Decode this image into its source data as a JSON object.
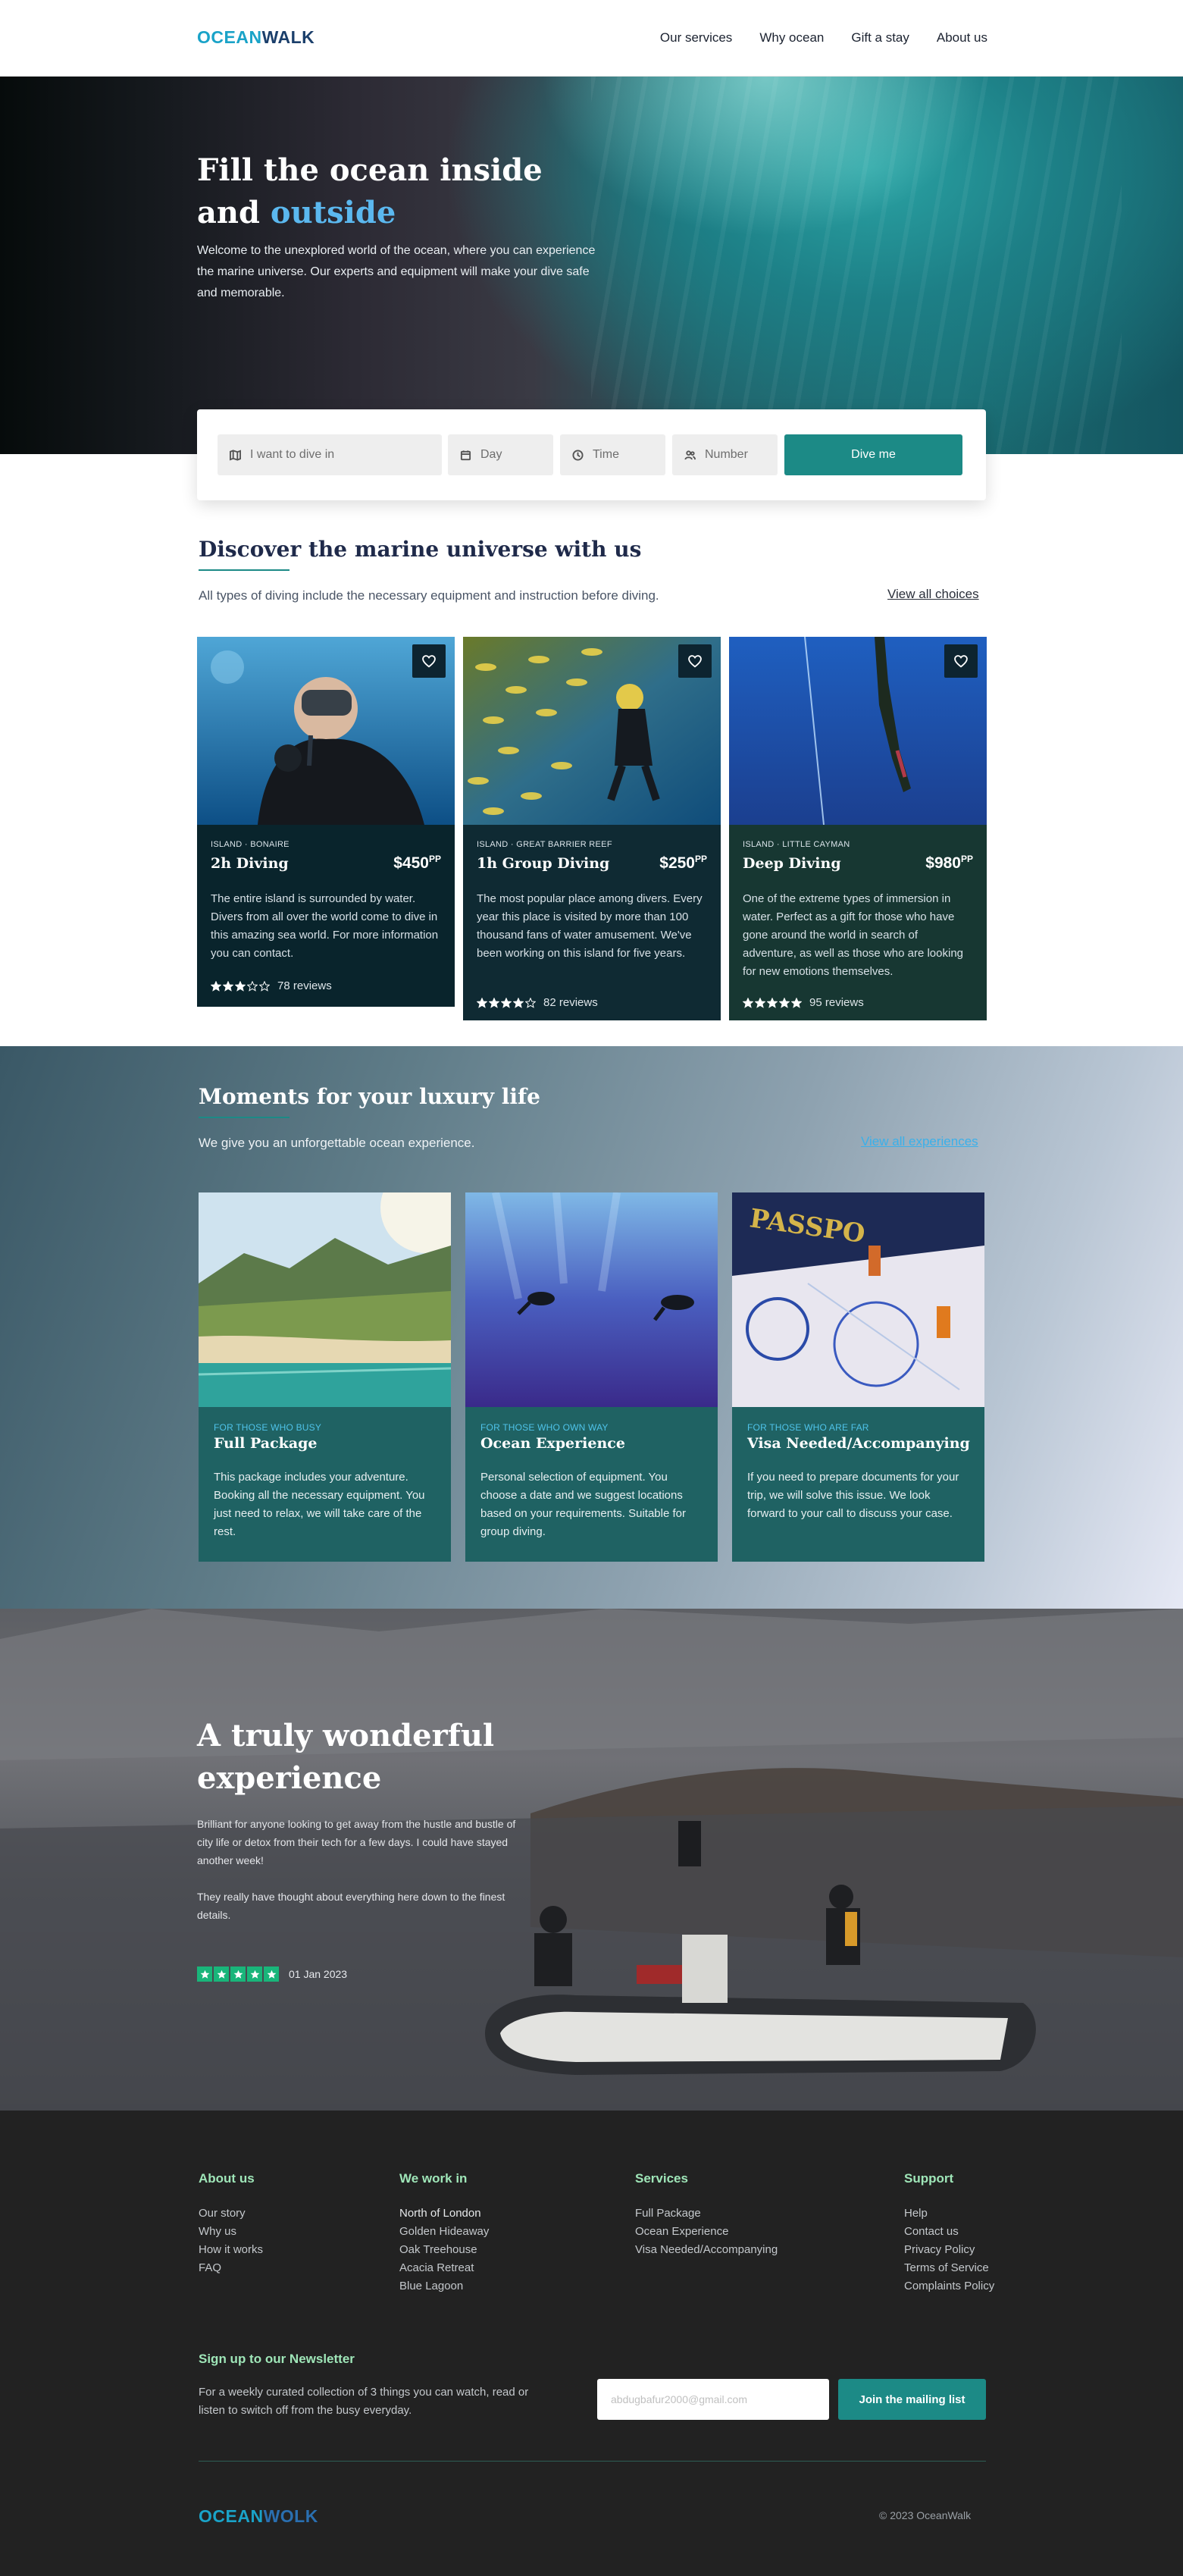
{
  "header": {
    "logo_part1": "OCEAN",
    "logo_part2": "WALK",
    "nav": [
      "Our services",
      "Why ocean",
      "Gift a stay",
      "About us"
    ]
  },
  "hero": {
    "title_line1": "Fill the ocean inside",
    "title_line2_prefix": "and ",
    "title_line2_accent": "outside",
    "description": "Welcome to the unexplored world of the ocean, where you can experience the marine universe. Our experts and equipment will make your dive safe and memorable."
  },
  "search": {
    "location_placeholder": "I want to dive in",
    "day_placeholder": "Day",
    "time_placeholder": "Time",
    "number_placeholder": "Number",
    "submit_label": "Dive me"
  },
  "discover": {
    "title": "Discover the marine universe with us",
    "subtitle": "All types of diving include the necessary equipment and instruction before diving.",
    "link": "View all choices",
    "cards": [
      {
        "location": "ISLAND · BONAIRE",
        "name": "2h Diving",
        "price": "$450",
        "price_unit": "PP",
        "description": "The entire island is surrounded by water. Divers from all over the world come to dive in this amazing sea world. For more information you can contact.",
        "rating": 3,
        "reviews": "78 reviews"
      },
      {
        "location": "ISLAND · GREAT BARRIER REEF",
        "name": "1h Group Diving",
        "price": "$250",
        "price_unit": "PP",
        "description": "The most popular place among divers. Every year this place is visited by more than 100 thousand fans of water amusement. We've been working on this island for five years.",
        "rating": 4,
        "reviews": "82 reviews"
      },
      {
        "location": "ISLAND · LITTLE CAYMAN",
        "name": "Deep Diving",
        "price": "$980",
        "price_unit": "PP",
        "description": "One of the extreme types of immersion in water. Perfect as a gift for those who have gone around the world in search of adventure, as well as those who are looking for new emotions themselves.",
        "rating": 5,
        "reviews": "95 reviews"
      }
    ]
  },
  "moments": {
    "title": "Moments for your luxury life",
    "subtitle": "We give you an unforgettable ocean experience.",
    "link": "View all experiences",
    "cards": [
      {
        "tag": "FOR THOSE WHO BUSY",
        "name": "Full Package",
        "description": "This package includes your adventure. Booking all the necessary equipment. You just need to relax, we will take care of the rest."
      },
      {
        "tag": "FOR THOSE WHO OWN WAY",
        "name": "Ocean Experience",
        "description": "Personal selection of equipment. You choose a date and we suggest locations based on your requirements. Suitable for group diving."
      },
      {
        "tag": "FOR THOSE WHO ARE FAR",
        "name": "Visa Needed/Accompanying",
        "description": "If you need to prepare documents for your trip, we will solve this issue. We look forward to your call to discuss your case."
      }
    ]
  },
  "testimonial": {
    "title": "A truly wonderful experience",
    "paragraph1": "Brilliant for anyone looking to get away from the hustle and bustle of city life or detox from their tech for a few days. I could have stayed another week!",
    "paragraph2": "They really have thought about everything here down to the finest details.",
    "rating": 5,
    "date": "01 Jan 2023"
  },
  "footer": {
    "columns": [
      {
        "title": "About us",
        "items": [
          "Our story",
          "Why us",
          "How it works",
          "FAQ"
        ]
      },
      {
        "title": "We work in",
        "items": [
          "North of London",
          "Golden Hideaway",
          "Oak Treehouse",
          "Acacia Retreat",
          "Blue Lagoon"
        ]
      },
      {
        "title": "Services",
        "items": [
          "Full Package",
          "Ocean Experience",
          "Visa Needed/Accompanying"
        ]
      },
      {
        "title": "Support",
        "items": [
          "Help",
          "Contact us",
          "Privacy Policy",
          "Terms of Service",
          "Complaints Policy"
        ]
      }
    ],
    "newsletter_title": "Sign up to our Newsletter",
    "newsletter_desc": "For a weekly curated collection of 3 things you can watch, read or listen to switch off from the busy everyday.",
    "email_placeholder": "abdugbafur2000@gmail.com",
    "join_label": "Join the mailing list",
    "logo_part1": "OCEAN",
    "logo_part2": "WOLK",
    "copyright": "© 2023 OceanWalk"
  },
  "colors": {
    "brand_teal": "#1c8a86",
    "accent_blue": "#5bb8ef",
    "star_green": "#19b57a",
    "footer_heading": "#9fe6b8"
  }
}
